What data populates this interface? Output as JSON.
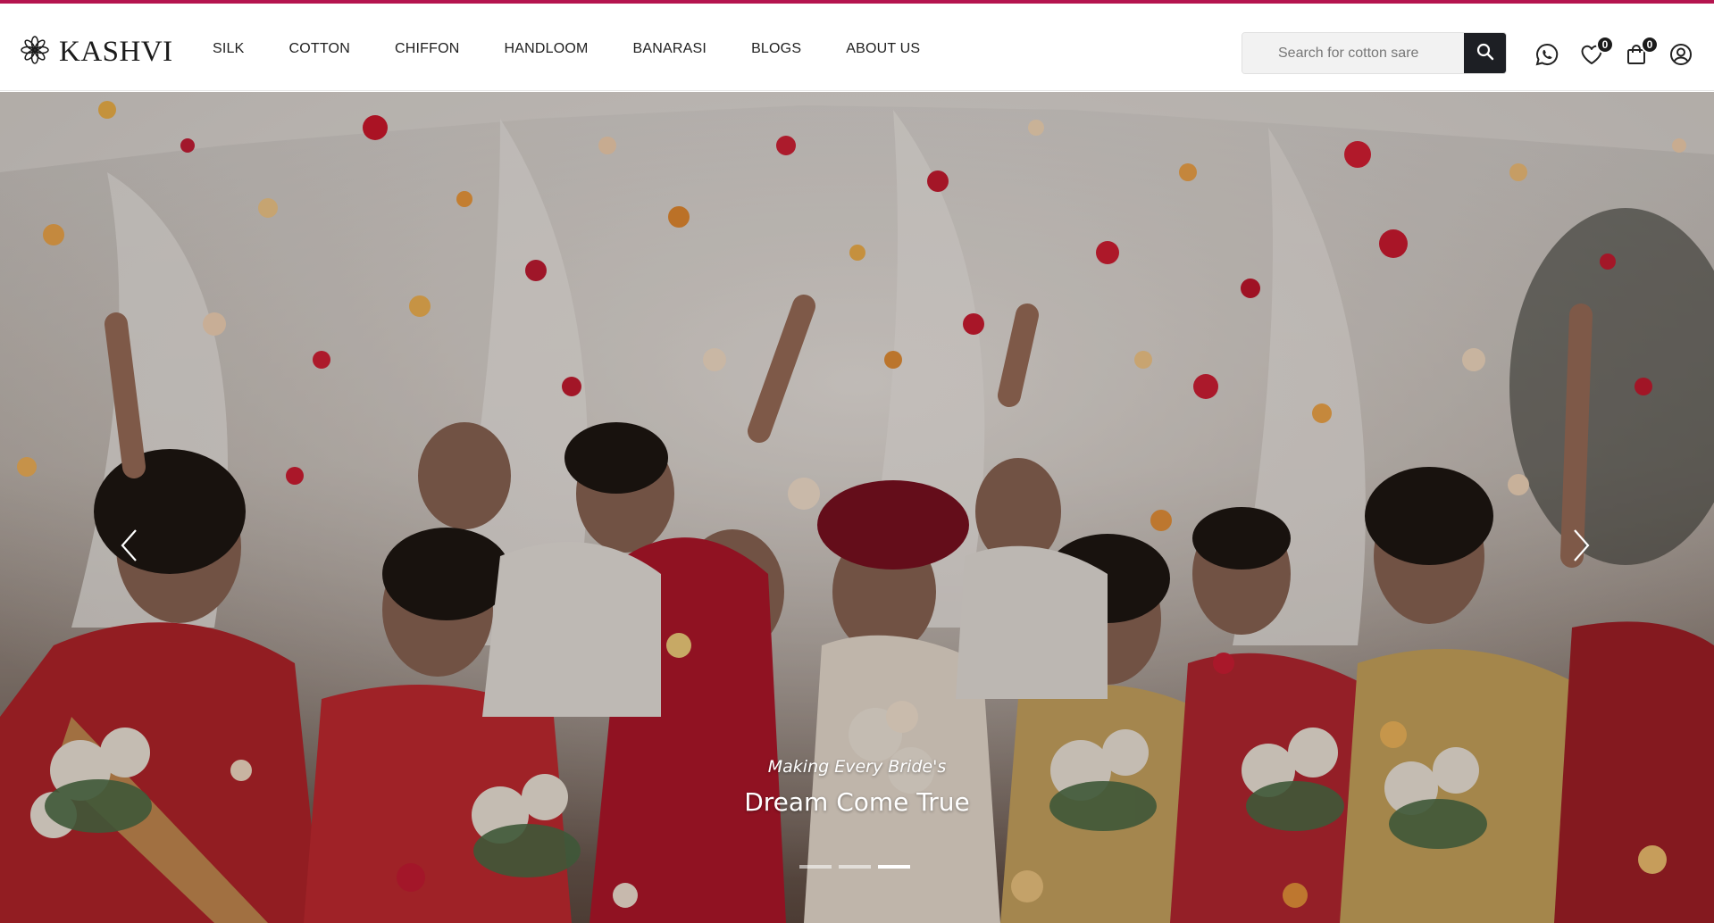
{
  "brand": {
    "name": "KASHVI",
    "logo_icon": "flower-icon"
  },
  "nav": {
    "items": [
      {
        "label": "SILK"
      },
      {
        "label": "COTTON"
      },
      {
        "label": "CHIFFON"
      },
      {
        "label": "HANDLOOM"
      },
      {
        "label": "BANARASI"
      },
      {
        "label": "BLOGS"
      },
      {
        "label": "ABOUT US"
      }
    ]
  },
  "search": {
    "placeholder": "Search for cotton sare",
    "value": "",
    "button_icon": "search-icon"
  },
  "header_icons": {
    "whatsapp": {
      "icon": "whatsapp-icon"
    },
    "wishlist": {
      "icon": "heart-icon",
      "count": "0"
    },
    "cart": {
      "icon": "shopping-bag-icon",
      "count": "0"
    },
    "account": {
      "icon": "user-icon"
    }
  },
  "hero": {
    "subtitle": "Making Every Bride's",
    "title": "Dream Come True",
    "prev_icon": "chevron-left-icon",
    "next_icon": "chevron-right-icon",
    "slides_total": 3,
    "active_slide": 3
  },
  "colors": {
    "accent": "#b5144f",
    "dark": "#1d1f24"
  }
}
